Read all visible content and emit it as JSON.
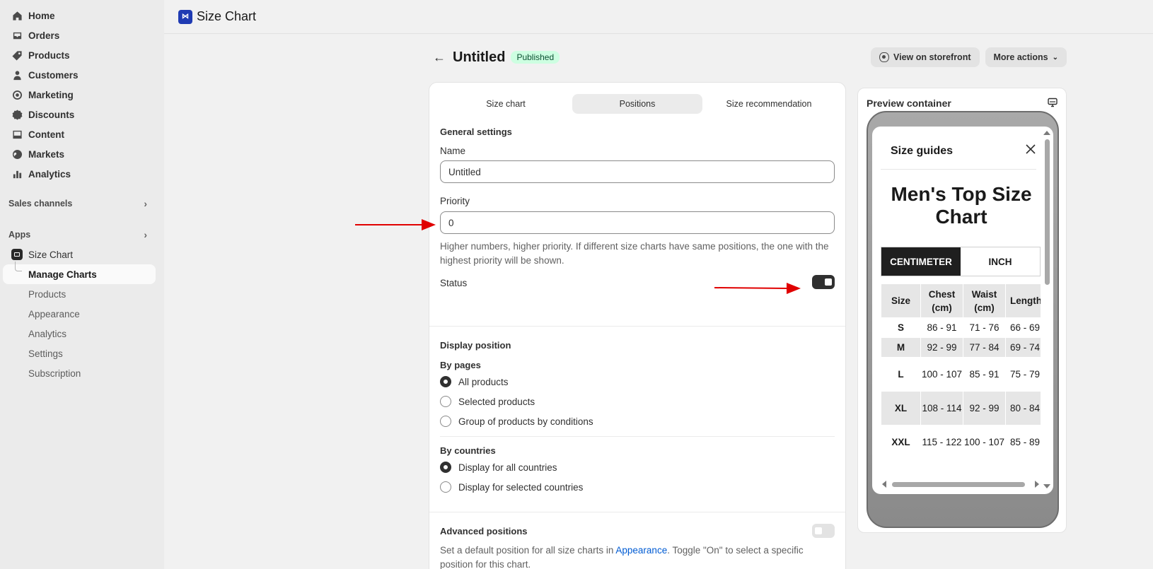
{
  "sidebar": {
    "items": [
      {
        "label": "Home",
        "icon": "home-icon"
      },
      {
        "label": "Orders",
        "icon": "inbox-icon"
      },
      {
        "label": "Products",
        "icon": "tag-icon"
      },
      {
        "label": "Customers",
        "icon": "person-icon"
      },
      {
        "label": "Marketing",
        "icon": "target-icon"
      },
      {
        "label": "Discounts",
        "icon": "discount-icon"
      },
      {
        "label": "Content",
        "icon": "content-icon"
      },
      {
        "label": "Markets",
        "icon": "globe-icon"
      },
      {
        "label": "Analytics",
        "icon": "bar-chart-icon"
      }
    ],
    "sales_channels": "Sales channels",
    "apps": "Apps",
    "app_name": "Size Chart",
    "app_subitems": [
      "Manage Charts",
      "Products",
      "Appearance",
      "Analytics",
      "Settings",
      "Subscription"
    ]
  },
  "topbar": {
    "title": "Size Chart"
  },
  "header": {
    "title": "Untitled",
    "badge": "Published",
    "view_storefront": "View on storefront",
    "more_actions": "More actions"
  },
  "tabs": [
    "Size chart",
    "Positions",
    "Size recommendation"
  ],
  "general": {
    "heading": "General settings",
    "name_label": "Name",
    "name_value": "Untitled",
    "priority_label": "Priority",
    "priority_value": "0",
    "priority_help": "Higher numbers, higher priority. If different size charts have same positions, the one with the highest priority will be shown.",
    "status_label": "Status",
    "status_on": true
  },
  "display": {
    "heading": "Display position",
    "by_pages": "By pages",
    "pages_options": [
      "All products",
      "Selected products",
      "Group of products by conditions"
    ],
    "pages_selected": 0,
    "by_countries": "By countries",
    "country_options": [
      "Display for all countries",
      "Display for selected countries"
    ],
    "country_selected": 0
  },
  "advanced": {
    "heading": "Advanced positions",
    "enabled": false,
    "help_prefix": "Set a default position for all size charts in ",
    "help_link": "Appearance",
    "help_suffix": ". Toggle \"On\" to select a specific position for this chart."
  },
  "preview": {
    "title": "Preview container",
    "guide_title": "Size guides",
    "chart_title": "Men's Top Size Chart",
    "units": [
      "CENTIMETER",
      "INCH"
    ],
    "unit_selected": 0,
    "table": {
      "headers": [
        "Size",
        "Chest (cm)",
        "Waist (cm)",
        "Length (cm)"
      ],
      "rows": [
        [
          "S",
          "86 - 91",
          "71 - 76",
          "66 - 69"
        ],
        [
          "M",
          "92 - 99",
          "77 - 84",
          "69 - 74"
        ],
        [
          "L",
          "100 - 107",
          "85 - 91",
          "75 - 79"
        ],
        [
          "XL",
          "108 - 114",
          "92 - 99",
          "80 - 84"
        ],
        [
          "XXL",
          "115 - 122",
          "100 - 107",
          "85 - 89"
        ]
      ]
    }
  },
  "colors": {
    "accent": "#303030",
    "badge_bg": "#cdfee1",
    "link": "#005bd3",
    "annotation_arrow": "#e00000"
  }
}
